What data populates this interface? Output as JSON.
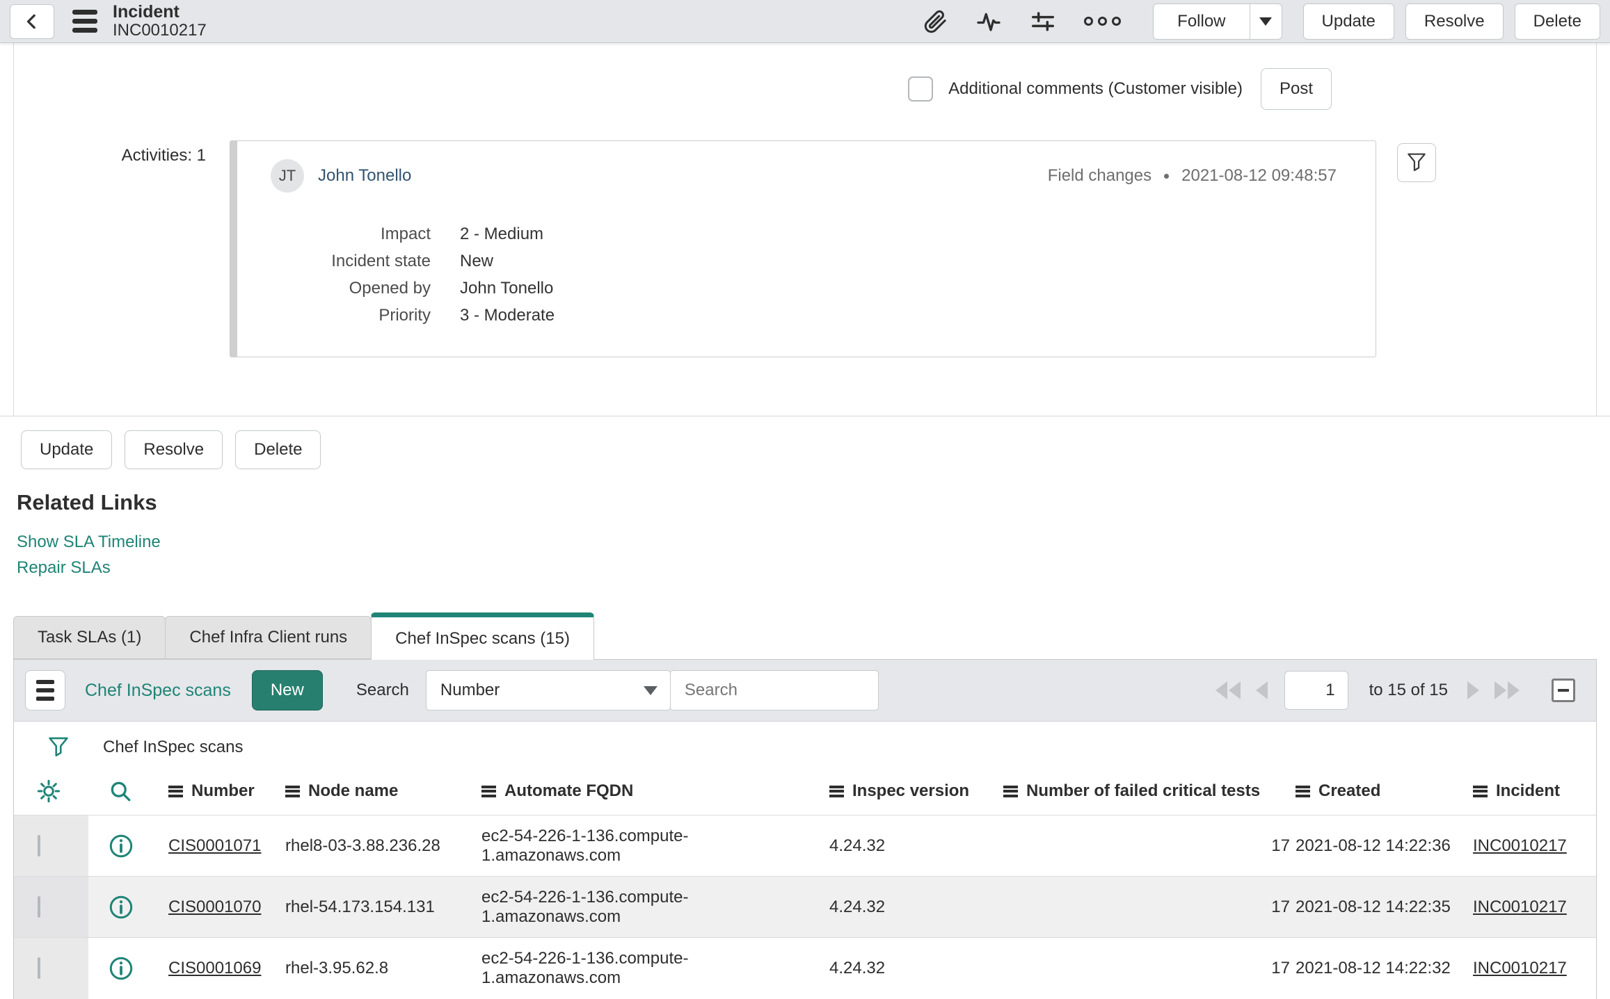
{
  "colors": {
    "accent_teal": "#1f8476",
    "new_button_bg": "#27806f",
    "topbar_bg": "#e4e6e9"
  },
  "header": {
    "title": "Incident",
    "record_number": "INC0010217",
    "follow_label": "Follow",
    "update_label": "Update",
    "resolve_label": "Resolve",
    "delete_label": "Delete"
  },
  "comments": {
    "checkbox_label": "Additional comments (Customer visible)",
    "post_label": "Post"
  },
  "activity": {
    "count_label": "Activities: 1",
    "entry": {
      "avatar_initials": "JT",
      "user_name": "John Tonello",
      "event_type": "Field changes",
      "timestamp": "2021-08-12 09:48:57",
      "changes": [
        {
          "field": "Impact",
          "value": "2 - Medium"
        },
        {
          "field": "Incident state",
          "value": "New"
        },
        {
          "field": "Opened by",
          "value": "John Tonello"
        },
        {
          "field": "Priority",
          "value": "3 - Moderate"
        }
      ]
    }
  },
  "form_actions": {
    "update": "Update",
    "resolve": "Resolve",
    "delete": "Delete"
  },
  "related_links": {
    "title": "Related Links",
    "links": [
      "Show SLA Timeline",
      "Repair SLAs"
    ]
  },
  "tabs": [
    {
      "label": "Task SLAs (1)"
    },
    {
      "label": "Chef Infra Client runs"
    },
    {
      "label": "Chef InSpec scans (15)"
    }
  ],
  "list": {
    "title": "Chef InSpec scans",
    "new_button": "New",
    "search_label": "Search",
    "search_field_selected": "Number",
    "search_placeholder": "Search",
    "pagination": {
      "page": "1",
      "range_label": "to 15 of 15"
    },
    "filter_breadcrumb": "Chef InSpec scans",
    "columns": [
      "Number",
      "Node name",
      "Automate FQDN",
      "Inspec version",
      "Number of failed critical tests",
      "Created",
      "Incident"
    ],
    "rows": [
      {
        "number": "CIS0001071",
        "node_name": "rhel8-03-3.88.236.28",
        "automate_fqdn": "ec2-54-226-1-136.compute-1.amazonaws.com",
        "inspec_version": "4.24.32",
        "failed_critical_tests": "17",
        "created": "2021-08-12 14:22:36",
        "incident": "INC0010217"
      },
      {
        "number": "CIS0001070",
        "node_name": "rhel-54.173.154.131",
        "automate_fqdn": "ec2-54-226-1-136.compute-1.amazonaws.com",
        "inspec_version": "4.24.32",
        "failed_critical_tests": "17",
        "created": "2021-08-12 14:22:35",
        "incident": "INC0010217"
      },
      {
        "number": "CIS0001069",
        "node_name": "rhel-3.95.62.8",
        "automate_fqdn": "ec2-54-226-1-136.compute-1.amazonaws.com",
        "inspec_version": "4.24.32",
        "failed_critical_tests": "17",
        "created": "2021-08-12 14:22:32",
        "incident": "INC0010217"
      }
    ]
  }
}
